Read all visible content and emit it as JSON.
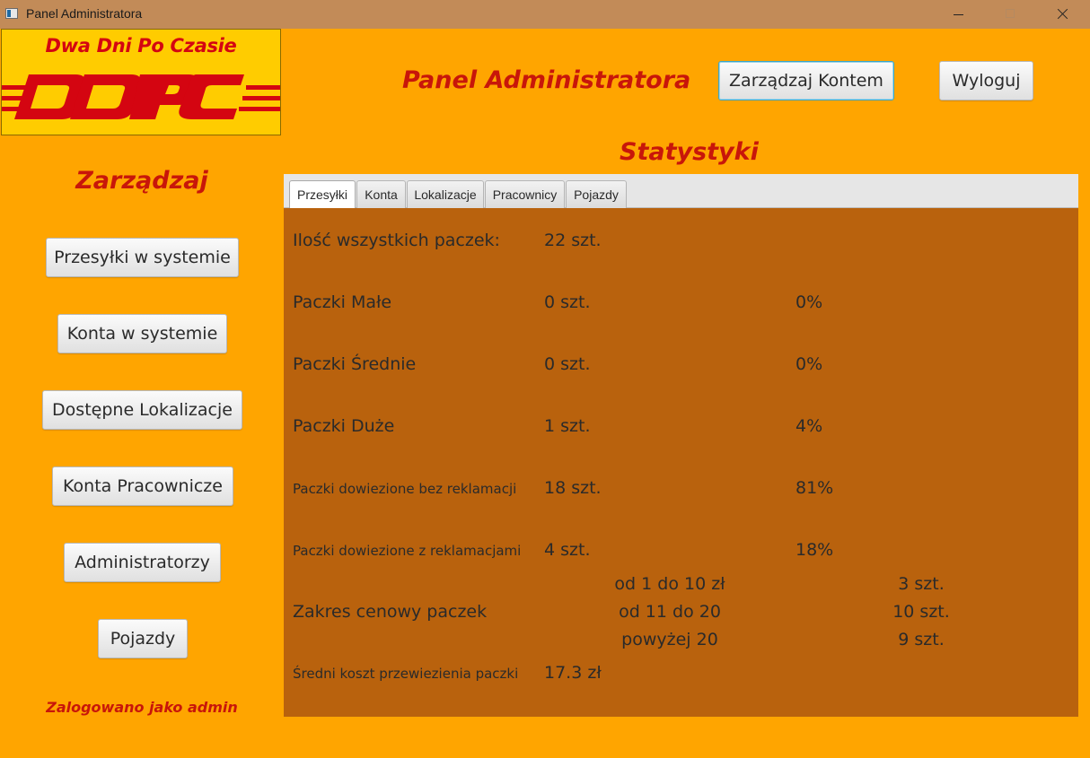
{
  "window": {
    "title": "Panel Administratora"
  },
  "logo": {
    "tagline": "Dwa Dni Po Czasie",
    "wordmark": "DDPC"
  },
  "header": {
    "title": "Panel Administratora",
    "manage_account": "Zarządzaj Kontem",
    "logout": "Wyloguj"
  },
  "sidebar": {
    "title": "Zarządzaj",
    "buttons": [
      "Przesyłki w systemie",
      "Konta w systemie",
      "Dostępne Lokalizacje",
      "Konta Pracownicze",
      "Administratorzy",
      "Pojazdy"
    ],
    "logged_in": "Zalogowano jako admin"
  },
  "stats": {
    "title": "Statystyki",
    "tabs": [
      "Przesyłki",
      "Konta",
      "Lokalizacje",
      "Pracownicy",
      "Pojazdy"
    ],
    "active_tab": "Przesyłki",
    "rows": [
      {
        "label": "Ilość wszystkich paczek:",
        "count": "22 szt.",
        "percent": ""
      },
      {
        "label": "Paczki Małe",
        "count": "0 szt.",
        "percent": "0%"
      },
      {
        "label": "Paczki Średnie",
        "count": "0 szt.",
        "percent": "0%"
      },
      {
        "label": "Paczki Duże",
        "count": "1 szt.",
        "percent": "4%"
      },
      {
        "label": "Paczki dowiezione bez reklamacji",
        "count": "18 szt.",
        "percent": "81%"
      },
      {
        "label": "Paczki dowiezione z reklamacjami",
        "count": "4 szt.",
        "percent": "18%"
      }
    ],
    "price_range": {
      "label": "Zakres cenowy paczek",
      "ranges": [
        {
          "range": "od 1 do 10 zł",
          "count": "3 szt."
        },
        {
          "range": "od 11 do 20",
          "count": "10 szt."
        },
        {
          "range": "powyżej 20",
          "count": "9 szt."
        }
      ]
    },
    "avg_cost": {
      "label": "Średni koszt przewiezienia paczki",
      "value": "17.3 zł"
    }
  },
  "colors": {
    "window_bg": "#ffa500",
    "titlebar": "#c28b58",
    "content_bg": "#b9620d",
    "accent_red": "#c8160a",
    "logo_yellow": "#ffcc00",
    "logo_red": "#d40511"
  }
}
